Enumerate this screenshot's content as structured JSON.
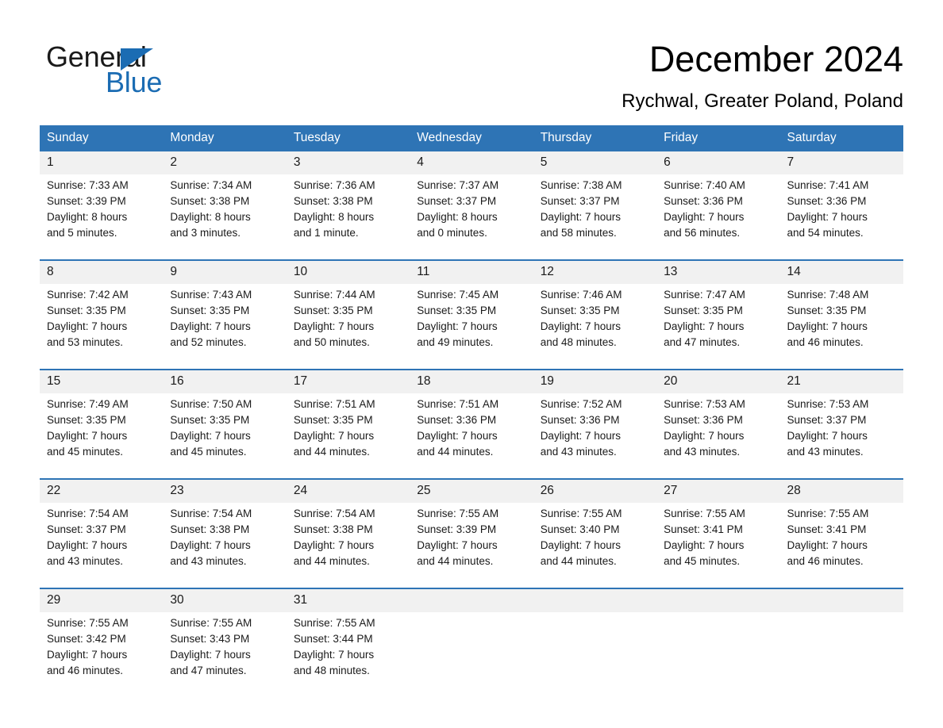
{
  "brand": {
    "name_part1": "General",
    "name_part2": "Blue",
    "accent_color": "#1b6cb3",
    "triangle_icon": "triangle-icon"
  },
  "header": {
    "month_title": "December 2024",
    "location": "Rychwal, Greater Poland, Poland"
  },
  "theme": {
    "header_blue": "#2e74b5",
    "date_band_gray": "#f1f1f1",
    "cell_white": "#ffffff",
    "text_dark": "#1a1a1a"
  },
  "weekday_headers": [
    "Sunday",
    "Monday",
    "Tuesday",
    "Wednesday",
    "Thursday",
    "Friday",
    "Saturday"
  ],
  "weeks": [
    {
      "dates": [
        "1",
        "2",
        "3",
        "4",
        "5",
        "6",
        "7"
      ],
      "cells": [
        {
          "sunrise": "Sunrise: 7:33 AM",
          "sunset": "Sunset: 3:39 PM",
          "daylight_1": "Daylight: 8 hours",
          "daylight_2": "and 5 minutes."
        },
        {
          "sunrise": "Sunrise: 7:34 AM",
          "sunset": "Sunset: 3:38 PM",
          "daylight_1": "Daylight: 8 hours",
          "daylight_2": "and 3 minutes."
        },
        {
          "sunrise": "Sunrise: 7:36 AM",
          "sunset": "Sunset: 3:38 PM",
          "daylight_1": "Daylight: 8 hours",
          "daylight_2": "and 1 minute."
        },
        {
          "sunrise": "Sunrise: 7:37 AM",
          "sunset": "Sunset: 3:37 PM",
          "daylight_1": "Daylight: 8 hours",
          "daylight_2": "and 0 minutes."
        },
        {
          "sunrise": "Sunrise: 7:38 AM",
          "sunset": "Sunset: 3:37 PM",
          "daylight_1": "Daylight: 7 hours",
          "daylight_2": "and 58 minutes."
        },
        {
          "sunrise": "Sunrise: 7:40 AM",
          "sunset": "Sunset: 3:36 PM",
          "daylight_1": "Daylight: 7 hours",
          "daylight_2": "and 56 minutes."
        },
        {
          "sunrise": "Sunrise: 7:41 AM",
          "sunset": "Sunset: 3:36 PM",
          "daylight_1": "Daylight: 7 hours",
          "daylight_2": "and 54 minutes."
        }
      ]
    },
    {
      "dates": [
        "8",
        "9",
        "10",
        "11",
        "12",
        "13",
        "14"
      ],
      "cells": [
        {
          "sunrise": "Sunrise: 7:42 AM",
          "sunset": "Sunset: 3:35 PM",
          "daylight_1": "Daylight: 7 hours",
          "daylight_2": "and 53 minutes."
        },
        {
          "sunrise": "Sunrise: 7:43 AM",
          "sunset": "Sunset: 3:35 PM",
          "daylight_1": "Daylight: 7 hours",
          "daylight_2": "and 52 minutes."
        },
        {
          "sunrise": "Sunrise: 7:44 AM",
          "sunset": "Sunset: 3:35 PM",
          "daylight_1": "Daylight: 7 hours",
          "daylight_2": "and 50 minutes."
        },
        {
          "sunrise": "Sunrise: 7:45 AM",
          "sunset": "Sunset: 3:35 PM",
          "daylight_1": "Daylight: 7 hours",
          "daylight_2": "and 49 minutes."
        },
        {
          "sunrise": "Sunrise: 7:46 AM",
          "sunset": "Sunset: 3:35 PM",
          "daylight_1": "Daylight: 7 hours",
          "daylight_2": "and 48 minutes."
        },
        {
          "sunrise": "Sunrise: 7:47 AM",
          "sunset": "Sunset: 3:35 PM",
          "daylight_1": "Daylight: 7 hours",
          "daylight_2": "and 47 minutes."
        },
        {
          "sunrise": "Sunrise: 7:48 AM",
          "sunset": "Sunset: 3:35 PM",
          "daylight_1": "Daylight: 7 hours",
          "daylight_2": "and 46 minutes."
        }
      ]
    },
    {
      "dates": [
        "15",
        "16",
        "17",
        "18",
        "19",
        "20",
        "21"
      ],
      "cells": [
        {
          "sunrise": "Sunrise: 7:49 AM",
          "sunset": "Sunset: 3:35 PM",
          "daylight_1": "Daylight: 7 hours",
          "daylight_2": "and 45 minutes."
        },
        {
          "sunrise": "Sunrise: 7:50 AM",
          "sunset": "Sunset: 3:35 PM",
          "daylight_1": "Daylight: 7 hours",
          "daylight_2": "and 45 minutes."
        },
        {
          "sunrise": "Sunrise: 7:51 AM",
          "sunset": "Sunset: 3:35 PM",
          "daylight_1": "Daylight: 7 hours",
          "daylight_2": "and 44 minutes."
        },
        {
          "sunrise": "Sunrise: 7:51 AM",
          "sunset": "Sunset: 3:36 PM",
          "daylight_1": "Daylight: 7 hours",
          "daylight_2": "and 44 minutes."
        },
        {
          "sunrise": "Sunrise: 7:52 AM",
          "sunset": "Sunset: 3:36 PM",
          "daylight_1": "Daylight: 7 hours",
          "daylight_2": "and 43 minutes."
        },
        {
          "sunrise": "Sunrise: 7:53 AM",
          "sunset": "Sunset: 3:36 PM",
          "daylight_1": "Daylight: 7 hours",
          "daylight_2": "and 43 minutes."
        },
        {
          "sunrise": "Sunrise: 7:53 AM",
          "sunset": "Sunset: 3:37 PM",
          "daylight_1": "Daylight: 7 hours",
          "daylight_2": "and 43 minutes."
        }
      ]
    },
    {
      "dates": [
        "22",
        "23",
        "24",
        "25",
        "26",
        "27",
        "28"
      ],
      "cells": [
        {
          "sunrise": "Sunrise: 7:54 AM",
          "sunset": "Sunset: 3:37 PM",
          "daylight_1": "Daylight: 7 hours",
          "daylight_2": "and 43 minutes."
        },
        {
          "sunrise": "Sunrise: 7:54 AM",
          "sunset": "Sunset: 3:38 PM",
          "daylight_1": "Daylight: 7 hours",
          "daylight_2": "and 43 minutes."
        },
        {
          "sunrise": "Sunrise: 7:54 AM",
          "sunset": "Sunset: 3:38 PM",
          "daylight_1": "Daylight: 7 hours",
          "daylight_2": "and 44 minutes."
        },
        {
          "sunrise": "Sunrise: 7:55 AM",
          "sunset": "Sunset: 3:39 PM",
          "daylight_1": "Daylight: 7 hours",
          "daylight_2": "and 44 minutes."
        },
        {
          "sunrise": "Sunrise: 7:55 AM",
          "sunset": "Sunset: 3:40 PM",
          "daylight_1": "Daylight: 7 hours",
          "daylight_2": "and 44 minutes."
        },
        {
          "sunrise": "Sunrise: 7:55 AM",
          "sunset": "Sunset: 3:41 PM",
          "daylight_1": "Daylight: 7 hours",
          "daylight_2": "and 45 minutes."
        },
        {
          "sunrise": "Sunrise: 7:55 AM",
          "sunset": "Sunset: 3:41 PM",
          "daylight_1": "Daylight: 7 hours",
          "daylight_2": "and 46 minutes."
        }
      ]
    },
    {
      "dates": [
        "29",
        "30",
        "31",
        "",
        "",
        "",
        ""
      ],
      "cells": [
        {
          "sunrise": "Sunrise: 7:55 AM",
          "sunset": "Sunset: 3:42 PM",
          "daylight_1": "Daylight: 7 hours",
          "daylight_2": "and 46 minutes."
        },
        {
          "sunrise": "Sunrise: 7:55 AM",
          "sunset": "Sunset: 3:43 PM",
          "daylight_1": "Daylight: 7 hours",
          "daylight_2": "and 47 minutes."
        },
        {
          "sunrise": "Sunrise: 7:55 AM",
          "sunset": "Sunset: 3:44 PM",
          "daylight_1": "Daylight: 7 hours",
          "daylight_2": "and 48 minutes."
        },
        {
          "sunrise": "",
          "sunset": "",
          "daylight_1": "",
          "daylight_2": ""
        },
        {
          "sunrise": "",
          "sunset": "",
          "daylight_1": "",
          "daylight_2": ""
        },
        {
          "sunrise": "",
          "sunset": "",
          "daylight_1": "",
          "daylight_2": ""
        },
        {
          "sunrise": "",
          "sunset": "",
          "daylight_1": "",
          "daylight_2": ""
        }
      ]
    }
  ]
}
